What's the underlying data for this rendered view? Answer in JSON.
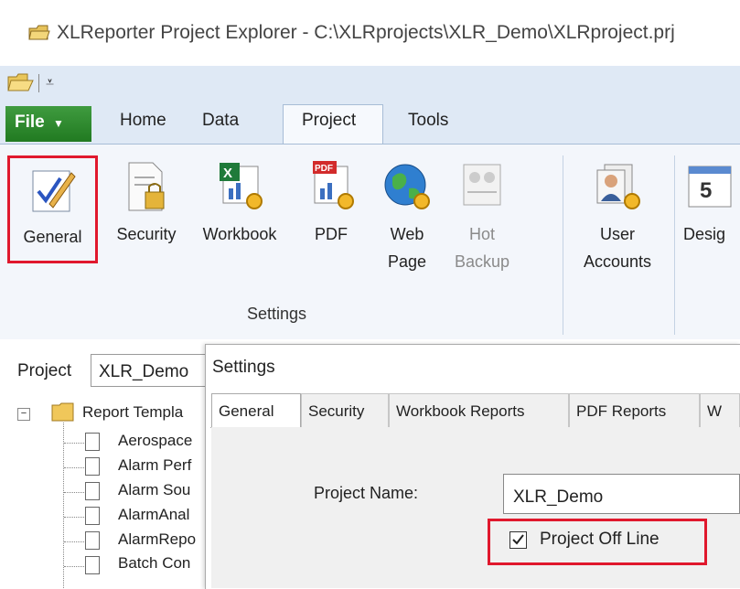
{
  "window": {
    "title": "XLReporter Project Explorer - C:\\XLRprojects\\XLR_Demo\\XLRproject.prj"
  },
  "ribbon": {
    "file_label": "File",
    "tabs": [
      "Home",
      "Data",
      "Project",
      "Tools"
    ],
    "active_tab": "Project",
    "buttons": [
      {
        "label": "General",
        "icon": "pencil-check-icon"
      },
      {
        "label": "Security",
        "icon": "document-lock-icon"
      },
      {
        "label": "Workbook",
        "icon": "excel-gear-icon"
      },
      {
        "label": "PDF",
        "icon": "pdf-gear-icon"
      },
      {
        "label": "Web",
        "label2": "Page",
        "icon": "globe-gear-icon"
      },
      {
        "label": "Hot",
        "label2": "Backup",
        "icon": "hot-backup-icon",
        "disabled": true
      },
      {
        "label": "User",
        "label2": "Accounts",
        "icon": "users-gear-icon"
      },
      {
        "label": "Desig",
        "icon": "calendar-icon"
      }
    ],
    "group_label": "Settings"
  },
  "project": {
    "label": "Project",
    "value": "XLR_Demo",
    "tree": {
      "root": "Report Templa",
      "items": [
        "Aerospace",
        "Alarm Perf",
        "Alarm Sou",
        "AlarmAnal",
        "AlarmRepo",
        "Batch Con"
      ]
    }
  },
  "dialog": {
    "title": "Settings",
    "tabs": [
      "General",
      "Security",
      "Workbook Reports",
      "PDF Reports",
      "W"
    ],
    "active_tab": "General",
    "project_name_label": "Project Name:",
    "project_name_value": "XLR_Demo",
    "offline_label": "Project Off Line",
    "offline_checked": true
  },
  "colors": {
    "highlight": "#e0182d",
    "file_tab": "#2f8a2f",
    "ribbon_bg": "#dfe9f5"
  }
}
